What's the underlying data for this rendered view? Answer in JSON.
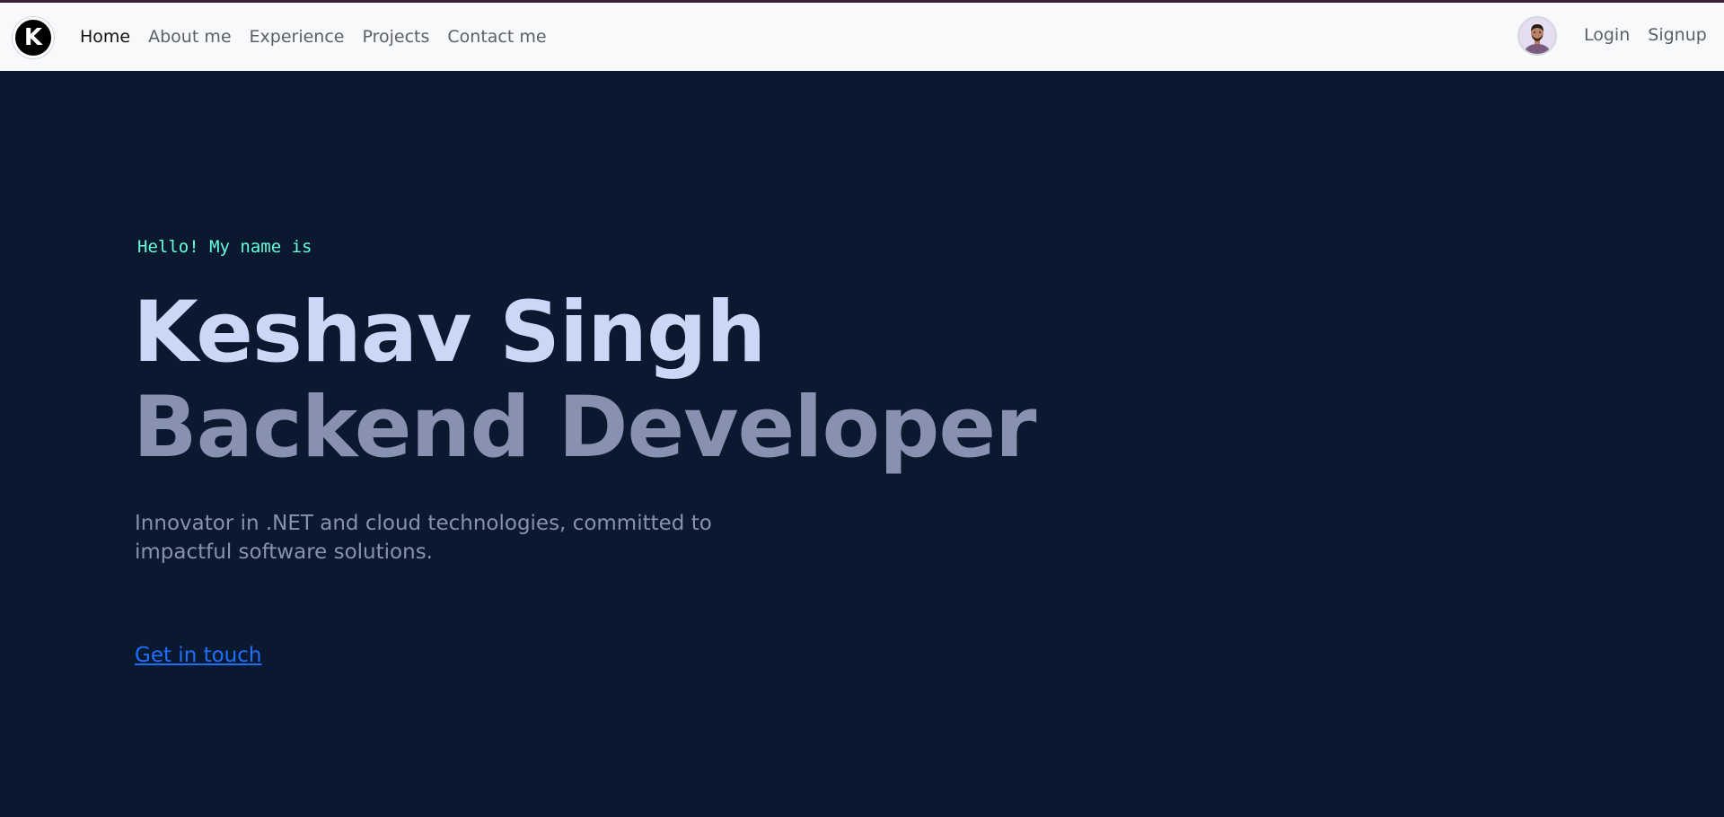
{
  "navbar": {
    "brand_letter": "K",
    "links": [
      {
        "label": "Home",
        "active": true
      },
      {
        "label": "About me",
        "active": false
      },
      {
        "label": "Experience",
        "active": false
      },
      {
        "label": "Projects",
        "active": false
      },
      {
        "label": "Contact me",
        "active": false
      }
    ],
    "auth": {
      "login_label": "Login",
      "signup_label": "Signup"
    }
  },
  "hero": {
    "greeting": "Hello! My name is",
    "name": "Keshav Singh",
    "role": "Backend Developer",
    "tagline": "Innovator in .NET and cloud technologies, committed to impactful software solutions.",
    "cta_label": "Get in touch"
  },
  "colors": {
    "background": "#0a192f",
    "navbar_bg": "#f8f9fb",
    "accent_green": "#64ffda",
    "name_color": "#ccd6f6",
    "role_color": "#8892b0",
    "link_blue": "#1e6fff"
  },
  "icons": {
    "brand": "k-logo-icon",
    "avatar": "user-avatar"
  }
}
